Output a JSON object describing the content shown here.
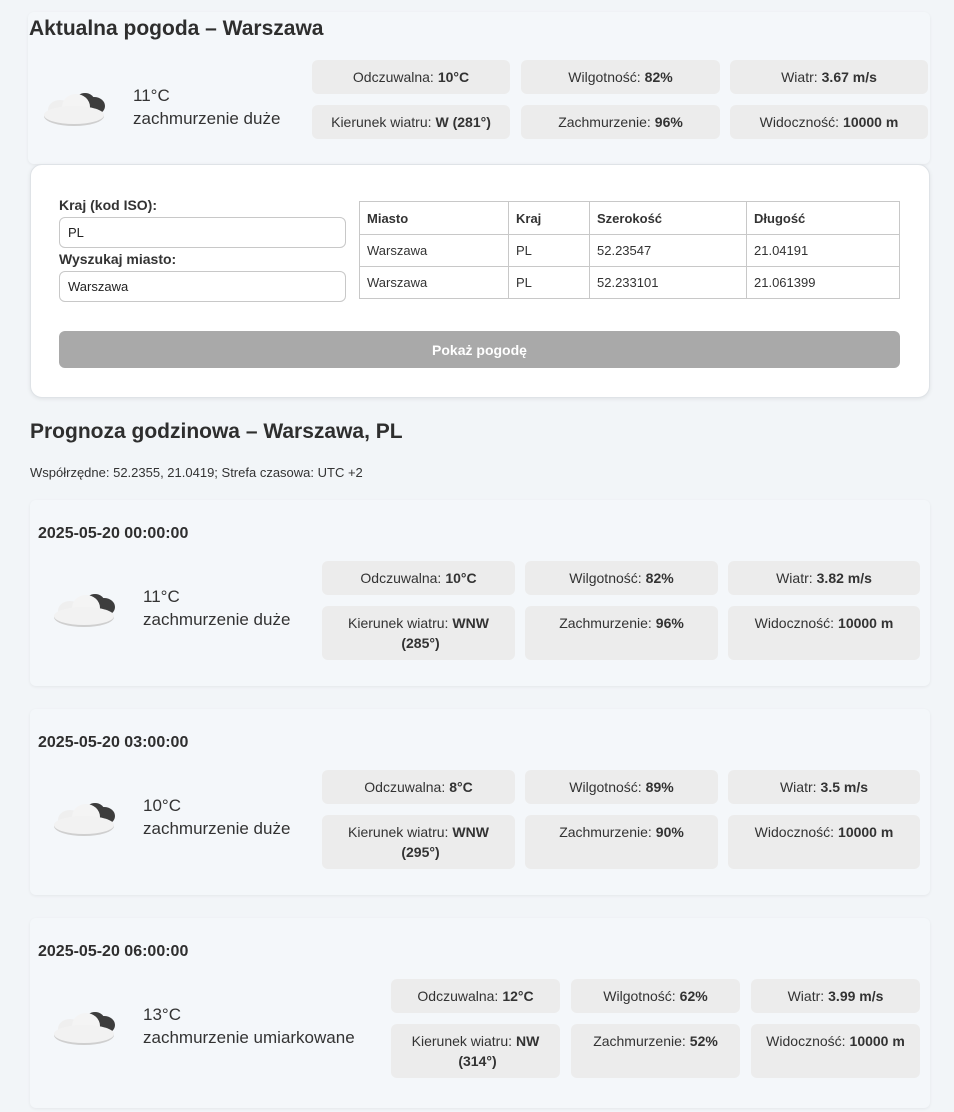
{
  "current": {
    "title": "Aktualna pogoda – Warszawa",
    "temp": "11°C",
    "desc": "zachmurzenie duże",
    "icon": "cloud-icon",
    "stats": [
      {
        "label": "Odczuwalna:",
        "value": "10°C"
      },
      {
        "label": "Wilgotność:",
        "value": "82%"
      },
      {
        "label": "Wiatr:",
        "value": "3.67 m/s"
      },
      {
        "label": "Kierunek wiatru:",
        "value": "W (281°)"
      },
      {
        "label": "Zachmurzenie:",
        "value": "96%"
      },
      {
        "label": "Widoczność:",
        "value": "10000 m"
      }
    ]
  },
  "search": {
    "country_label": "Kraj (kod ISO):",
    "country_value": "PL",
    "city_label": "Wyszukaj miasto:",
    "city_value": "Warszawa",
    "button_label": "Pokaż pogodę",
    "table": {
      "headers": [
        "Miasto",
        "Kraj",
        "Szerokość",
        "Długość"
      ],
      "rows": [
        [
          "Warszawa",
          "PL",
          "52.23547",
          "21.04191"
        ],
        [
          "Warszawa",
          "PL",
          "52.233101",
          "21.061399"
        ]
      ]
    }
  },
  "forecast": {
    "title": "Prognoza godzinowa – Warszawa, PL",
    "meta": "Współrzędne: 52.2355, 21.0419; Strefa czasowa: UTC +2",
    "entries": [
      {
        "time": "2025-05-20 00:00:00",
        "temp": "11°C",
        "desc": "zachmurzenie duże",
        "stats": [
          {
            "label": "Odczuwalna:",
            "value": "10°C"
          },
          {
            "label": "Wilgotność:",
            "value": "82%"
          },
          {
            "label": "Wiatr:",
            "value": "3.82 m/s"
          },
          {
            "label": "Kierunek wiatru:",
            "value": "WNW",
            "value2": "(285°)"
          },
          {
            "label": "Zachmurzenie:",
            "value": "96%"
          },
          {
            "label": "Widoczność:",
            "value": "10000 m"
          }
        ]
      },
      {
        "time": "2025-05-20 03:00:00",
        "temp": "10°C",
        "desc": "zachmurzenie duże",
        "stats": [
          {
            "label": "Odczuwalna:",
            "value": "8°C"
          },
          {
            "label": "Wilgotność:",
            "value": "89%"
          },
          {
            "label": "Wiatr:",
            "value": "3.5 m/s"
          },
          {
            "label": "Kierunek wiatru:",
            "value": "WNW",
            "value2": "(295°)"
          },
          {
            "label": "Zachmurzenie:",
            "value": "90%"
          },
          {
            "label": "Widoczność:",
            "value": "10000 m"
          }
        ]
      },
      {
        "time": "2025-05-20 06:00:00",
        "temp": "13°C",
        "desc": "zachmurzenie umiarkowane",
        "stats": [
          {
            "label": "Odczuwalna:",
            "value": "12°C"
          },
          {
            "label": "Wilgotność:",
            "value": "62%"
          },
          {
            "label": "Wiatr:",
            "value": "3.99 m/s"
          },
          {
            "label": "Kierunek wiatru:",
            "value": "NW",
            "value2": "(314°)"
          },
          {
            "label": "Zachmurzenie:",
            "value": "52%"
          },
          {
            "label": "Widoczność:",
            "value": "10000 m"
          }
        ]
      }
    ]
  }
}
